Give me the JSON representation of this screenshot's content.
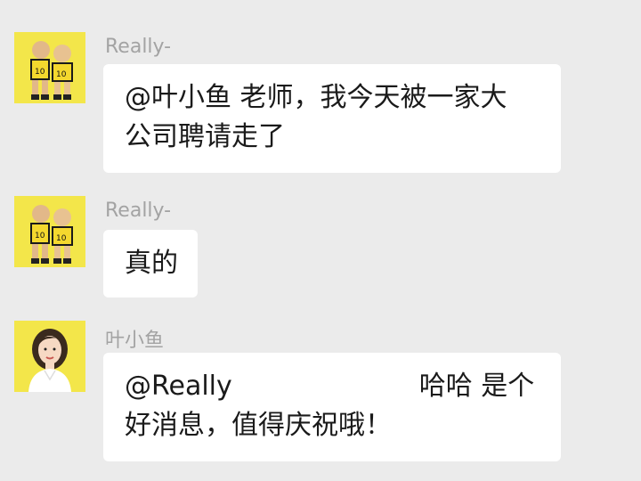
{
  "messages": [
    {
      "sender": "Really-",
      "avatar": "players-avatar",
      "lines": [
        "@叶小鱼  老师，我今天被一家大",
        "公司聘请走了"
      ]
    },
    {
      "sender": "Really-",
      "avatar": "players-avatar",
      "lines": [
        "真的"
      ]
    },
    {
      "sender": "叶小鱼",
      "avatar": "woman-avatar",
      "mention": "@Really",
      "line1_rest": "哈哈 是个",
      "line2": "好消息，值得庆祝哦！"
    }
  ],
  "colors": {
    "background": "#ebebeb",
    "bubble": "#ffffff",
    "sender_name": "#a3a3a3",
    "avatar_bg": "#f3e64a"
  }
}
